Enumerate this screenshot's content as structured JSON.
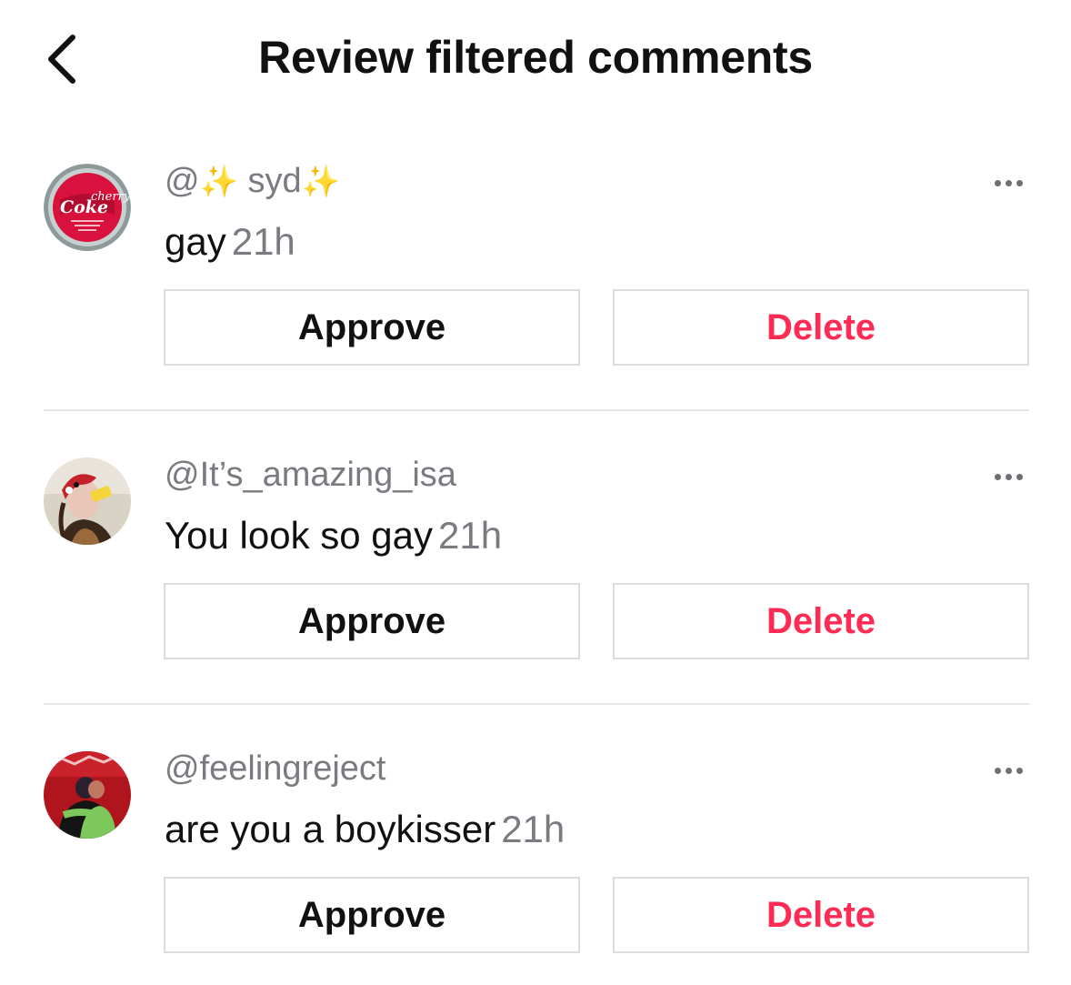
{
  "header": {
    "title": "Review filtered comments",
    "back_icon": "chevron-left-icon"
  },
  "colors": {
    "delete": "#fe2c55",
    "sparkle": "#f5c518",
    "muted": "#7a7b80"
  },
  "comments": [
    {
      "username_prefix": "@",
      "username_sparkle": "✨",
      "username_name": "syd",
      "text": "gay",
      "time": "21h",
      "approve_label": "Approve",
      "delete_label": "Delete",
      "avatar_icon": "cherry-coke-bottle-cap-avatar",
      "avatar_text_1": "cherry",
      "avatar_text_2": "Coke"
    },
    {
      "username": "@It’s_amazing_isa",
      "text": "You look so gay",
      "time": "21h",
      "approve_label": "Approve",
      "delete_label": "Delete",
      "avatar_icon": "selfie-photo-avatar"
    },
    {
      "username": "@feelingreject",
      "text": "are you a boykisser",
      "time": "21h",
      "approve_label": "Approve",
      "delete_label": "Delete",
      "avatar_icon": "hug-photo-avatar"
    }
  ]
}
